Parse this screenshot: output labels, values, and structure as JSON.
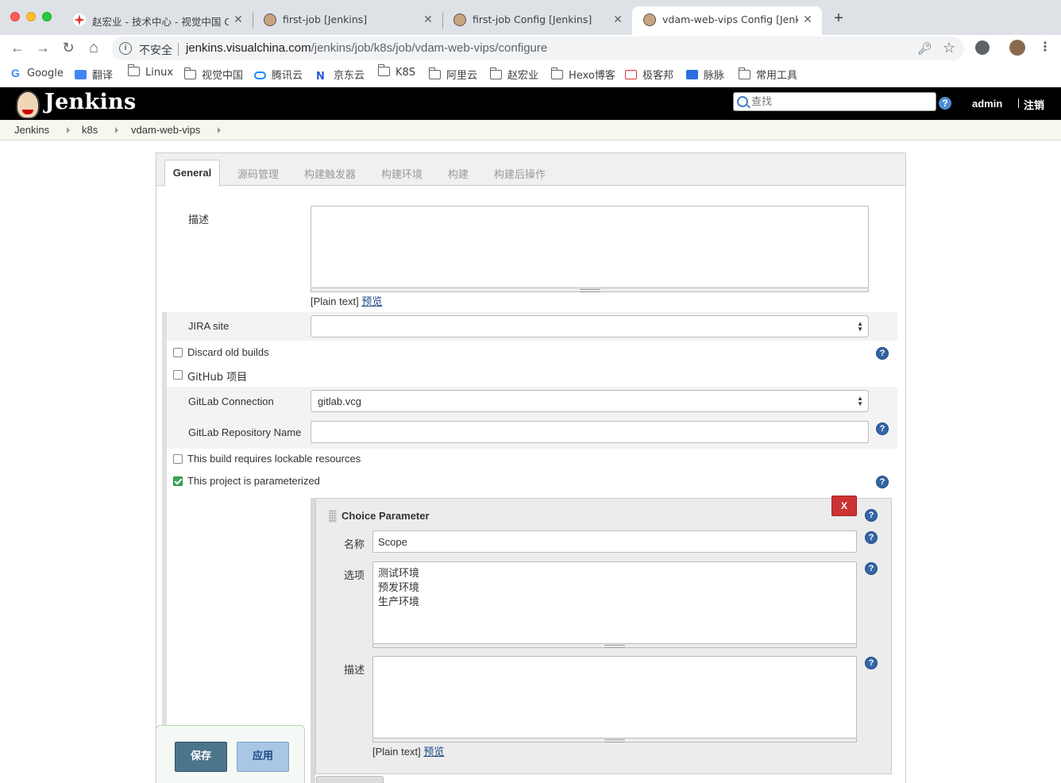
{
  "browser": {
    "tabs": [
      {
        "title": "赵宏业 - 技术中心 - 视觉中国 Co",
        "favicon_color": "#d9342b",
        "active": false
      },
      {
        "title": "first-job [Jenkins]",
        "favicon_color": "#c9a27e",
        "active": false
      },
      {
        "title": "first-job Config [Jenkins]",
        "favicon_color": "#c9a27e",
        "active": false
      },
      {
        "title": "vdam-web-vips Config [Jenkins]",
        "favicon_color": "#c9a27e",
        "active": true
      }
    ],
    "new_tab_label": "+",
    "close_label": "✕",
    "nav": {
      "back": "←",
      "forward": "→",
      "reload": "↻",
      "home": "⌂"
    },
    "address": {
      "security_label": "不安全",
      "host": "jenkins.visualchina.com",
      "path": "/jenkins/job/k8s/job/vdam-web-vips/configure"
    },
    "bookmarks": [
      {
        "label": "Google",
        "icon": "google-icon"
      },
      {
        "label": "翻译",
        "icon": "translate-icon"
      },
      {
        "label": "Linux",
        "icon": "folder-icon"
      },
      {
        "label": "视觉中国",
        "icon": "folder-icon"
      },
      {
        "label": "腾讯云",
        "icon": "cloud-icon"
      },
      {
        "label": "京东云",
        "icon": "jd-cloud-icon"
      },
      {
        "label": "K8S",
        "icon": "folder-icon"
      },
      {
        "label": "阿里云",
        "icon": "folder-icon"
      },
      {
        "label": "赵宏业",
        "icon": "folder-icon"
      },
      {
        "label": "Hexo博客",
        "icon": "folder-icon"
      },
      {
        "label": "极客邦",
        "icon": "geekbang-icon"
      },
      {
        "label": "脉脉",
        "icon": "maimai-icon"
      },
      {
        "label": "常用工具",
        "icon": "folder-icon"
      }
    ]
  },
  "jenkins": {
    "logo_text": "Jenkins",
    "search_placeholder": "查找",
    "help_label": "?",
    "user": "admin",
    "logout": "注销",
    "breadcrumbs": [
      "Jenkins",
      "k8s",
      "vdam-web-vips"
    ]
  },
  "config": {
    "tabs": [
      "General",
      "源码管理",
      "构建触发器",
      "构建环境",
      "构建",
      "构建后操作"
    ],
    "description_label": "描述",
    "description_value": "",
    "markup_label": "[Plain text]",
    "preview_link": "预览",
    "jira_site_label": "JIRA site",
    "jira_site_value": "",
    "discard_old_builds_label": "Discard old builds",
    "discard_old_builds_checked": false,
    "github_project_label": "GitHub 项目",
    "github_project_checked": false,
    "gitlab_connection_label": "GitLab Connection",
    "gitlab_connection_value": "gitlab.vcg",
    "gitlab_repo_label": "GitLab Repository Name",
    "gitlab_repo_value": "",
    "lockable_label": "This build requires lockable resources",
    "lockable_checked": false,
    "parameterized_label": "This project is parameterized",
    "parameterized_checked": true,
    "choice_param": {
      "title": "Choice Parameter",
      "delete_label": "X",
      "name_label": "名称",
      "name_value": "Scope",
      "choices_label": "选项",
      "choices_value": "测试环境\n预发环境\n生产环境",
      "description_label": "描述",
      "description_value": "",
      "markup_label": "[Plain text]",
      "preview_link": "预览"
    },
    "save_label": "保存",
    "apply_label": "应用"
  }
}
